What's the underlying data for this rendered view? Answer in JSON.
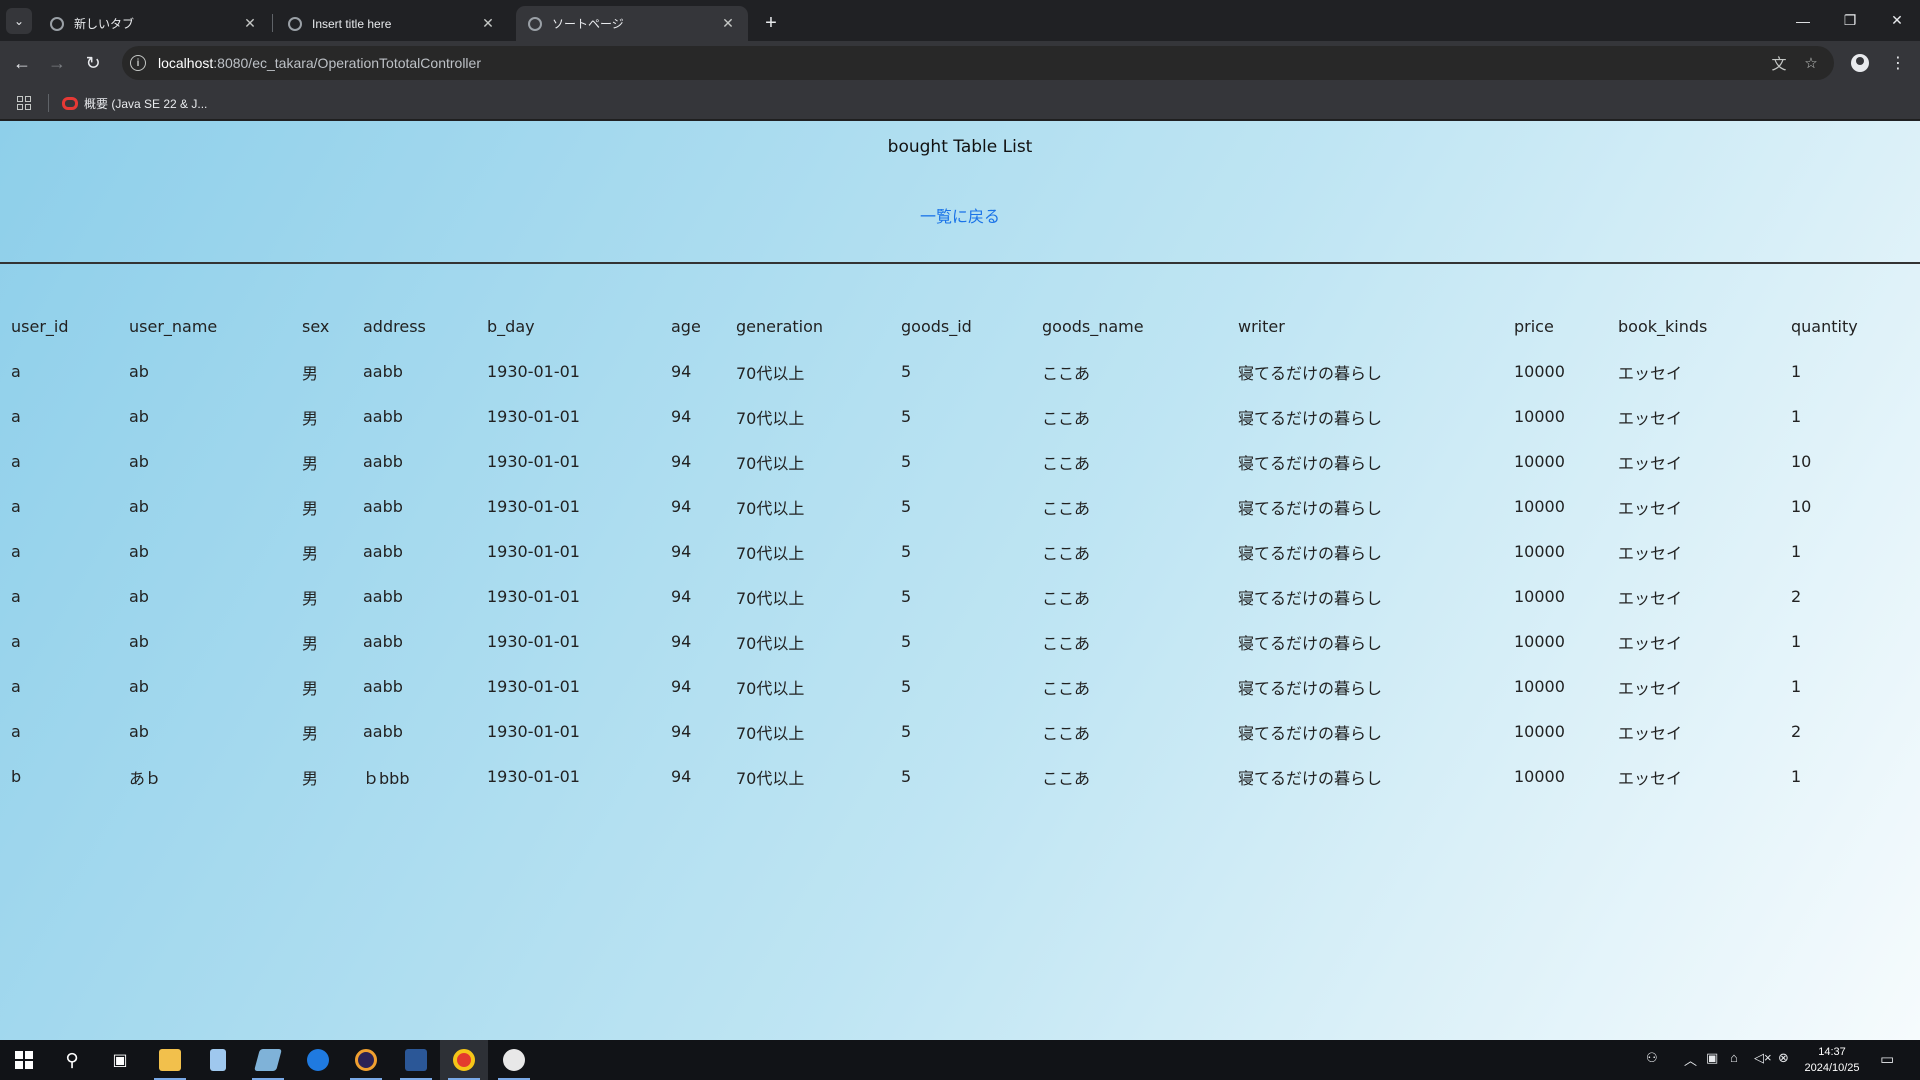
{
  "browser": {
    "tabs": [
      {
        "title": "新しいタブ"
      },
      {
        "title": "Insert title here"
      },
      {
        "title": "ソートページ"
      }
    ],
    "url_host": "localhost",
    "url_path": ":8080/ec_takara/OperationTototalController",
    "bookmark": "概要 (Java SE 22 & J..."
  },
  "page": {
    "title": "bought Table List",
    "back_link": "一覧に戻る"
  },
  "table": {
    "columns": [
      "user_id",
      "user_name",
      "sex",
      "address",
      "b_day",
      "age",
      "generation",
      "goods_id",
      "goods_name",
      "writer",
      "price",
      "book_kinds",
      "quantity"
    ],
    "rows": [
      [
        "a",
        "ab",
        "男",
        "aabb",
        "1930-01-01",
        "94",
        "70代以上",
        "5",
        "ここあ",
        "寝てるだけの暮らし",
        "10000",
        "エッセイ",
        "1"
      ],
      [
        "a",
        "ab",
        "男",
        "aabb",
        "1930-01-01",
        "94",
        "70代以上",
        "5",
        "ここあ",
        "寝てるだけの暮らし",
        "10000",
        "エッセイ",
        "1"
      ],
      [
        "a",
        "ab",
        "男",
        "aabb",
        "1930-01-01",
        "94",
        "70代以上",
        "5",
        "ここあ",
        "寝てるだけの暮らし",
        "10000",
        "エッセイ",
        "10"
      ],
      [
        "a",
        "ab",
        "男",
        "aabb",
        "1930-01-01",
        "94",
        "70代以上",
        "5",
        "ここあ",
        "寝てるだけの暮らし",
        "10000",
        "エッセイ",
        "10"
      ],
      [
        "a",
        "ab",
        "男",
        "aabb",
        "1930-01-01",
        "94",
        "70代以上",
        "5",
        "ここあ",
        "寝てるだけの暮らし",
        "10000",
        "エッセイ",
        "1"
      ],
      [
        "a",
        "ab",
        "男",
        "aabb",
        "1930-01-01",
        "94",
        "70代以上",
        "5",
        "ここあ",
        "寝てるだけの暮らし",
        "10000",
        "エッセイ",
        "2"
      ],
      [
        "a",
        "ab",
        "男",
        "aabb",
        "1930-01-01",
        "94",
        "70代以上",
        "5",
        "ここあ",
        "寝てるだけの暮らし",
        "10000",
        "エッセイ",
        "1"
      ],
      [
        "a",
        "ab",
        "男",
        "aabb",
        "1930-01-01",
        "94",
        "70代以上",
        "5",
        "ここあ",
        "寝てるだけの暮らし",
        "10000",
        "エッセイ",
        "1"
      ],
      [
        "a",
        "ab",
        "男",
        "aabb",
        "1930-01-01",
        "94",
        "70代以上",
        "5",
        "ここあ",
        "寝てるだけの暮らし",
        "10000",
        "エッセイ",
        "2"
      ],
      [
        "b",
        "あｂ",
        "男",
        "ｂbbb",
        "1930-01-01",
        "94",
        "70代以上",
        "5",
        "ここあ",
        "寝てるだけの暮らし",
        "10000",
        "エッセイ",
        "1"
      ]
    ]
  },
  "taskbar": {
    "time": "14:37",
    "date": "2024/10/25"
  }
}
